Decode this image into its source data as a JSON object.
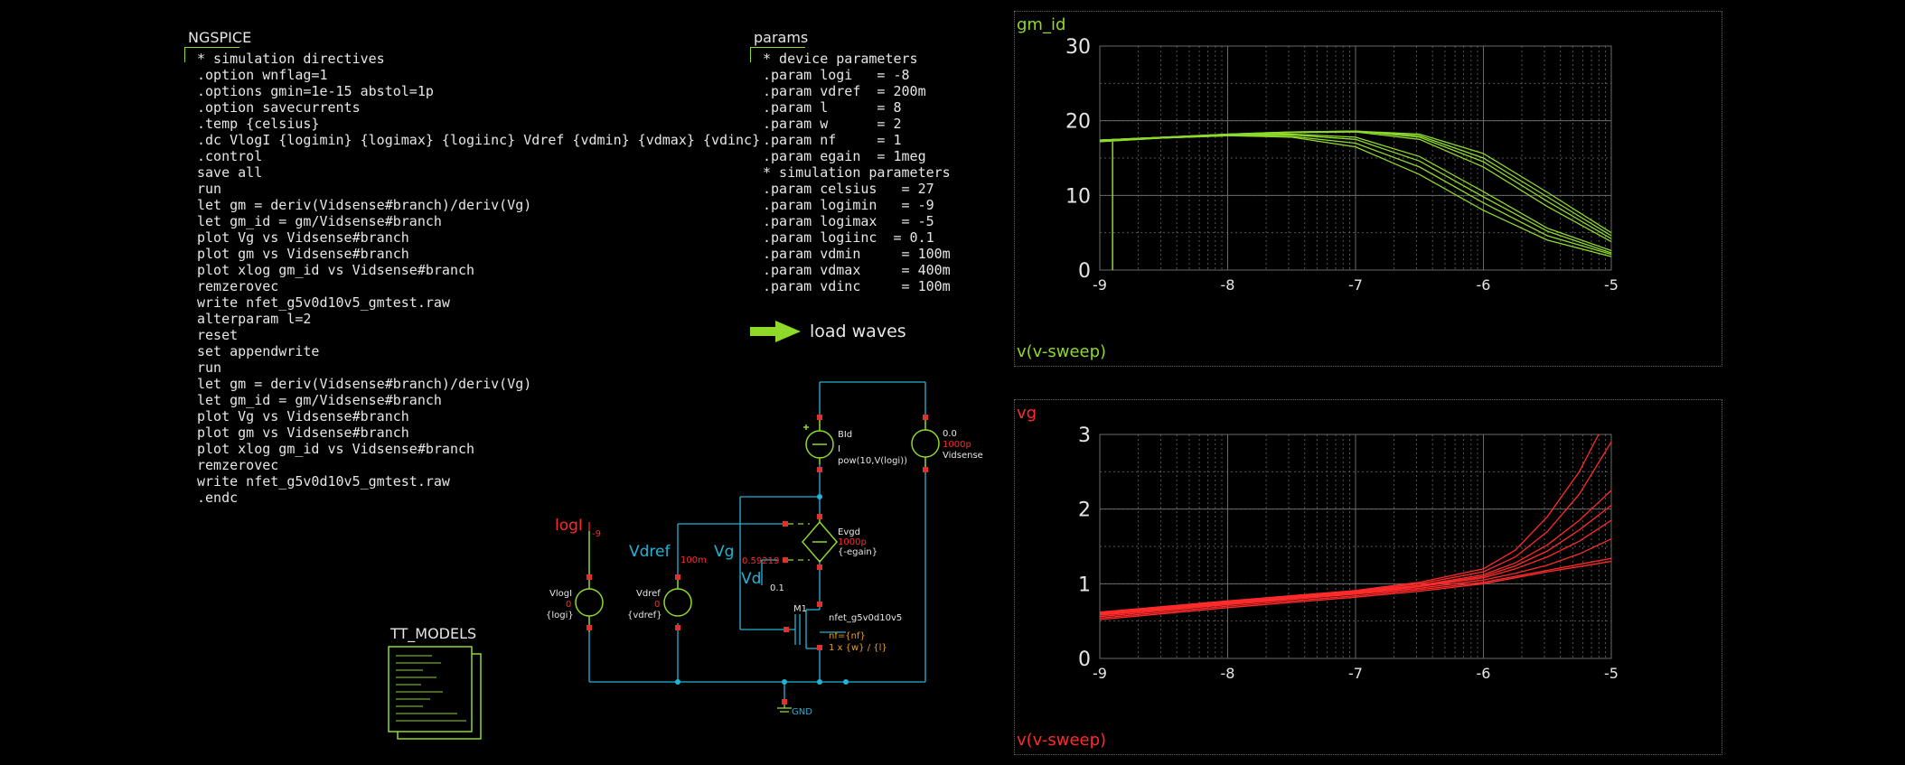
{
  "ngspice": {
    "title": "NGSPICE",
    "lines": [
      "* simulation directives",
      ".option wnflag=1",
      ".options gmin=1e-15 abstol=1p",
      ".option savecurrents",
      ".temp {celsius}",
      ".dc VlogI {logimin} {logimax} {logiinc} Vdref {vdmin} {vdmax} {vdinc}",
      ".control",
      "save all",
      "run",
      "let gm = deriv(Vidsense#branch)/deriv(Vg)",
      "let gm_id = gm/Vidsense#branch",
      "plot Vg vs Vidsense#branch",
      "plot gm vs Vidsense#branch",
      "plot xlog gm_id vs Vidsense#branch",
      "remzerovec",
      "write nfet_g5v0d10v5_gmtest.raw",
      "alterparam l=2",
      "reset",
      "set appendwrite",
      "run",
      "let gm = deriv(Vidsense#branch)/deriv(Vg)",
      "let gm_id = gm/Vidsense#branch",
      "plot Vg vs Vidsense#branch",
      "plot gm vs Vidsense#branch",
      "plot xlog gm_id vs Vidsense#branch",
      "remzerovec",
      "write nfet_g5v0d10v5_gmtest.raw",
      ".endc"
    ]
  },
  "params": {
    "title": "params",
    "lines": [
      "* device parameters",
      ".param logi   = -8",
      ".param vdref  = 200m",
      ".param l      = 8",
      ".param w      = 2",
      ".param nf     = 1",
      ".param egain  = 1meg",
      "* simulation parameters",
      ".param celsius   = 27",
      ".param logimin   = -9",
      ".param logimax   = -5",
      ".param logiinc  = 0.1",
      ".param vdmin     = 100m",
      ".param vdmax     = 400m",
      ".param vdinc     = 100m"
    ]
  },
  "load_waves": {
    "label": "load waves"
  },
  "tt_models": {
    "label": "TT_MODELS"
  },
  "schematic": {
    "labels": {
      "logI": "logI",
      "logI_val": "-9",
      "vdref_lab": "Vdref",
      "vdref_val": "100m",
      "vg_lab": "Vg",
      "vg_val": "0.59219",
      "vd_lab": "Vd",
      "vd_val": "0.1",
      "vlogi_name": "VlogI",
      "vlogi_v": "0",
      "vlogi_expr": "{logi}",
      "vdref_src_name": "Vdref",
      "vdref_src_v": "0",
      "vdref_src_expr": "{vdref}",
      "bid_name": "BId",
      "bid_i": "I",
      "bid_expr": "pow(10,V(logi))",
      "vids_v": "0.0",
      "vids_i": "1000p",
      "vids_name": "Vidsense",
      "evgd_name": "Evgd",
      "evgd_v": "1000p",
      "evgd_expr": "{-egain}",
      "m1_name": "M1",
      "m1_model": "nfet_g5v0d10v5",
      "m1_nf": "nf={nf}",
      "m1_size": "1 x {w} / {l}",
      "gnd": "GND"
    }
  },
  "colors": {
    "green": "#8fd92b",
    "red": "#ff2a2a",
    "cyan": "#22b4d6",
    "grid": "#4a4a4a"
  },
  "chart_data": [
    {
      "type": "line",
      "title": "gm_id",
      "xlabel": "v(v-sweep)",
      "xlim": [
        -9,
        -5
      ],
      "ylim": [
        0,
        30
      ],
      "xticks": [
        "-9",
        "-8",
        "-7",
        "-6",
        "-5"
      ],
      "yticks": [
        "0",
        "10",
        "20",
        "30"
      ],
      "series": [
        {
          "x": [
            -9,
            -8.5,
            -8,
            -7.5,
            -7,
            -6.5,
            -6,
            -5.5,
            -5
          ],
          "values": [
            17.2,
            17.7,
            18.0,
            17.8,
            16.5,
            12.8,
            8.0,
            4.0,
            1.8
          ]
        },
        {
          "x": [
            -9,
            -8.5,
            -8,
            -7.5,
            -7,
            -6.5,
            -6,
            -5.5,
            -5
          ],
          "values": [
            17.2,
            17.7,
            18.0,
            17.9,
            17.0,
            13.8,
            9.0,
            4.6,
            2.1
          ]
        },
        {
          "x": [
            -9,
            -8.5,
            -8,
            -7.5,
            -7,
            -6.5,
            -6,
            -5.5,
            -5
          ],
          "values": [
            17.3,
            17.7,
            18.0,
            18.1,
            17.5,
            14.6,
            9.8,
            5.2,
            2.3
          ]
        },
        {
          "x": [
            -9,
            -8.5,
            -8,
            -7.5,
            -7,
            -6.5,
            -6,
            -5.5,
            -5
          ],
          "values": [
            17.3,
            17.7,
            18.1,
            18.2,
            17.8,
            15.2,
            10.5,
            5.6,
            2.6
          ]
        },
        {
          "x": [
            -9,
            -8.5,
            -8,
            -7.5,
            -7,
            -6.5,
            -6,
            -5.5,
            -5
          ],
          "values": [
            17.4,
            17.8,
            18.1,
            18.4,
            18.5,
            17.5,
            13.8,
            8.5,
            3.8
          ]
        },
        {
          "x": [
            -9,
            -8.5,
            -8,
            -7.5,
            -7,
            -6.5,
            -6,
            -5.5,
            -5
          ],
          "values": [
            17.4,
            17.8,
            18.1,
            18.4,
            18.6,
            17.8,
            14.5,
            9.2,
            4.2
          ]
        },
        {
          "x": [
            -9,
            -8.5,
            -8,
            -7.5,
            -7,
            -6.5,
            -6,
            -5.5,
            -5
          ],
          "values": [
            17.4,
            17.8,
            18.2,
            18.5,
            18.6,
            18.0,
            15.0,
            9.8,
            4.6
          ]
        },
        {
          "x": [
            -9,
            -8.5,
            -8,
            -7.5,
            -7,
            -6.5,
            -6,
            -5.5,
            -5
          ],
          "values": [
            17.4,
            17.8,
            18.2,
            18.5,
            18.6,
            18.2,
            15.6,
            10.4,
            5.0
          ]
        }
      ]
    },
    {
      "type": "line",
      "title": "vg",
      "xlabel": "v(v-sweep)",
      "xlim": [
        -9,
        -5
      ],
      "ylim": [
        0,
        3
      ],
      "xticks": [
        "-9",
        "-8",
        "-7",
        "-6",
        "-5"
      ],
      "yticks": [
        "0",
        "1",
        "2",
        "3"
      ],
      "series": [
        {
          "x": [
            -9,
            -8,
            -7,
            -6.5,
            -6,
            -5.75,
            -5.5,
            -5.25,
            -5
          ],
          "values": [
            0.52,
            0.68,
            0.82,
            0.9,
            1.0,
            1.08,
            1.16,
            1.23,
            1.3
          ]
        },
        {
          "x": [
            -9,
            -8,
            -7,
            -6.5,
            -6,
            -5.75,
            -5.5,
            -5.25,
            -5
          ],
          "values": [
            0.54,
            0.7,
            0.84,
            0.92,
            1.02,
            1.1,
            1.18,
            1.26,
            1.34
          ]
        },
        {
          "x": [
            -9,
            -8,
            -7,
            -6.5,
            -6,
            -5.75,
            -5.5,
            -5.25,
            -5
          ],
          "values": [
            0.56,
            0.72,
            0.86,
            0.94,
            1.05,
            1.14,
            1.25,
            1.4,
            1.6
          ]
        },
        {
          "x": [
            -9,
            -8,
            -7,
            -6.5,
            -6,
            -5.75,
            -5.5,
            -5.25,
            -5
          ],
          "values": [
            0.58,
            0.73,
            0.87,
            0.96,
            1.08,
            1.2,
            1.36,
            1.57,
            1.85
          ]
        },
        {
          "x": [
            -9,
            -8,
            -7,
            -6.5,
            -6,
            -5.75,
            -5.5,
            -5.25,
            -5
          ],
          "values": [
            0.59,
            0.74,
            0.88,
            0.97,
            1.1,
            1.24,
            1.44,
            1.72,
            2.05
          ]
        },
        {
          "x": [
            -9,
            -8,
            -7,
            -6.5,
            -6,
            -5.75,
            -5.5,
            -5.25,
            -5
          ],
          "values": [
            0.6,
            0.75,
            0.89,
            0.98,
            1.12,
            1.28,
            1.52,
            1.85,
            2.25
          ]
        },
        {
          "x": [
            -9,
            -8,
            -7,
            -6.5,
            -6,
            -5.75,
            -5.5,
            -5.25,
            -5
          ],
          "values": [
            0.61,
            0.76,
            0.9,
            1.0,
            1.16,
            1.36,
            1.7,
            2.2,
            2.9
          ]
        },
        {
          "x": [
            -9,
            -8,
            -7,
            -6.5,
            -6,
            -5.75,
            -5.5,
            -5.25,
            -5.1
          ],
          "values": [
            0.62,
            0.77,
            0.91,
            1.02,
            1.2,
            1.45,
            1.9,
            2.5,
            3.0
          ]
        }
      ]
    }
  ]
}
